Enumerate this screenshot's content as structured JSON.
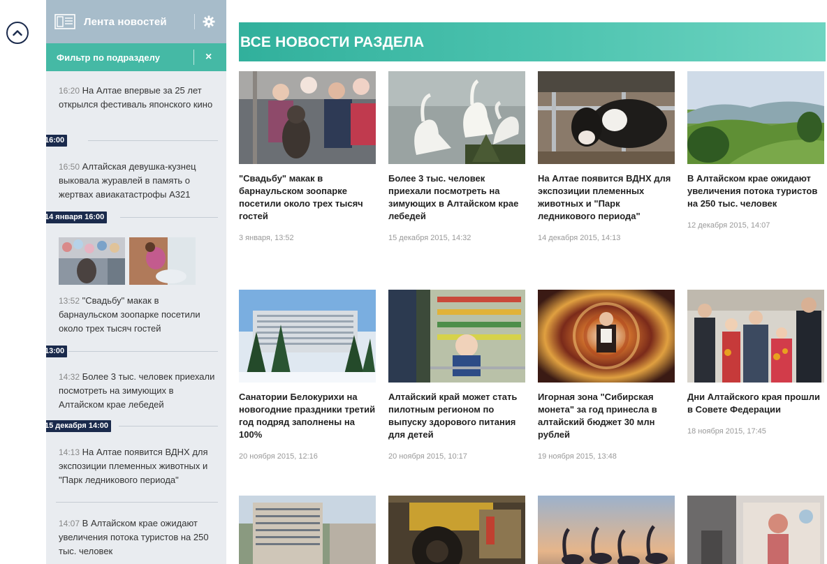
{
  "collapse_icon": "chevron-up-icon",
  "sidebar": {
    "title": "Лента новостей",
    "filter_label": "Фильтр по подразделу",
    "close_label": "×",
    "items": [
      {
        "time": "16:20",
        "text": "На Алтае впервые за 25 лет открылся фестиваль японского кино"
      },
      {
        "time": "16:50",
        "text": "Алтайская девушка-кузнец выковала журавлей в память о жертвах авиакатастрофы А321"
      },
      {
        "time": "13:52",
        "text": "\"Свадьбу\" макак в барнаульском зоопарке посетили около трех тысяч гостей"
      },
      {
        "time": "14:32",
        "text": "Более 3 тыс. человек приехали посмотреть на зимующих в Алтайском крае лебедей"
      },
      {
        "time": "14:13",
        "text": "На Алтае появится ВДНХ для экспозиции племенных животных и \"Парк ледникового периода\""
      },
      {
        "time": "14:07",
        "text": "В Алтайском крае ожидают увеличения потока туристов на 250 тыс. человек"
      }
    ],
    "markers": [
      "16:00",
      "14 января 16:00",
      "13:00",
      "15 декабря 14:00"
    ]
  },
  "main": {
    "banner_title": "ВСЕ НОВОСТИ РАЗДЕЛА",
    "cards": [
      {
        "headline": "\"Свадьбу\" макак в барнаульском зоопарке посетили около трех тысяч гостей",
        "date": "3 января, 13:52"
      },
      {
        "headline": "Более 3 тыс. человек приехали посмотреть на зимующих в Алтайском крае лебедей",
        "date": "15 декабря 2015, 14:32"
      },
      {
        "headline": "На Алтае появится ВДНХ для экспозиции племенных животных и \"Парк ледникового периода\"",
        "date": "14 декабря 2015, 14:13"
      },
      {
        "headline": "В Алтайском крае ожидают увеличения потока туристов на 250 тыс. человек",
        "date": "12 декабря 2015, 14:07"
      },
      {
        "headline": "Санатории Белокурихи на новогодние праздники третий год подряд заполнены на 100%",
        "date": "20 ноября 2015, 12:16"
      },
      {
        "headline": "Алтайский край может стать пилотным регионом по выпуску здорового питания для детей",
        "date": "20 ноября 2015, 10:17"
      },
      {
        "headline": "Игорная зона \"Сибирская монета\" за год принесла в алтайский бюджет 30 млн рублей",
        "date": "19 ноября 2015, 13:48"
      },
      {
        "headline": "Дни Алтайского края прошли в Совете Федерации",
        "date": "18 ноября 2015, 17:45"
      }
    ]
  },
  "colors": {
    "sidebar_bg": "#e9ecf0",
    "sidebar_header": "#a7bcca",
    "filter_bar": "#45b9a5",
    "marker": "#1a2a4c",
    "banner": "#31b09c"
  }
}
